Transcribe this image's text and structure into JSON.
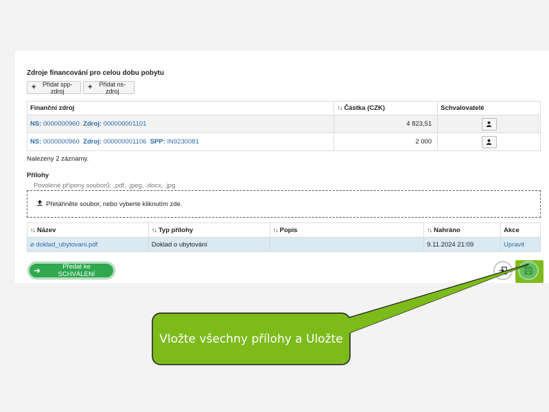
{
  "financing": {
    "title": "Zdroje financování pro celou dobu pobytu",
    "add_spp_label": "Přidat spp-zdroj",
    "add_ns_label": "Přidat ns-zdroj",
    "columns": [
      "Finanční zdroj",
      "Částka (CZK)",
      "Schvalovatelé"
    ],
    "rows": [
      {
        "ns_label": "NS:",
        "ns_value": "0000000960",
        "zdroj_label": "Zdroj:",
        "zdroj_value": "000000001101",
        "spp_label": "",
        "spp_value": "",
        "amount": "4 823,51"
      },
      {
        "ns_label": "NS:",
        "ns_value": "0000000960",
        "zdroj_label": "Zdroj:",
        "zdroj_value": "000000001106",
        "spp_label": "SPP:",
        "spp_value": "IN9230081",
        "amount": "2 000"
      }
    ],
    "found_text": "Nalezeny 2 záznamy."
  },
  "attachments": {
    "title": "Přílohy",
    "allowed_text": "Povolené přípony souborů: .pdf, .jpeg, .docx, .jpg",
    "dropzone_text": "Přetáhněte soubor, nebo vyberte kliknutím zde.",
    "columns": [
      "Název",
      "Typ přílohy",
      "Popis",
      "Nahráno",
      "Akce"
    ],
    "rows": [
      {
        "name": "doklad_ubytovani.pdf",
        "type": "Doklad o ubytování",
        "description": "",
        "uploaded": "9.11.2024 21:09",
        "action": "Upravit"
      }
    ]
  },
  "actions": {
    "submit_label": "Předat ke SCHVÁLENÍ"
  },
  "callout": {
    "text": "Vložte všechny přílohy a Uložte",
    "color": "#7dbb1b"
  },
  "icons": {
    "add": "plus-icon",
    "sort": "sort-icon",
    "user": "user-icon",
    "upload": "upload-icon",
    "attachment": "link-icon",
    "submit": "arrow-right-icon",
    "exit": "exit-icon",
    "save": "floppy-disk-icon"
  }
}
